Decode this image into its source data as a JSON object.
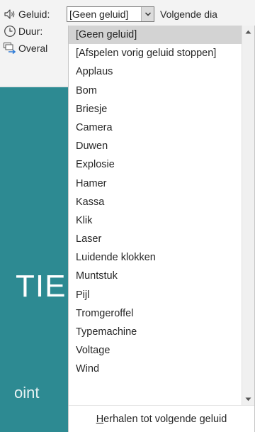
{
  "toolbar": {
    "sound_label": "Geluid:",
    "sound_value": "[Geen geluid]",
    "next_slide_label": "Volgende dia",
    "duration_label": "Duur:",
    "apply_all_label": "Overal"
  },
  "slide_preview": {
    "big_text": "TIE",
    "small_text": "oint"
  },
  "sound_list": {
    "items": [
      "[Geen geluid]",
      "[Afspelen vorig geluid stoppen]",
      "Applaus",
      "Bom",
      "Briesje",
      "Camera",
      "Duwen",
      "Explosie",
      "Hamer",
      "Kassa",
      "Klik",
      "Laser",
      "Luidende klokken",
      "Muntstuk",
      "Pijl",
      "Tromgeroffel",
      "Typemachine",
      "Voltage",
      "Wind"
    ],
    "selected_index": 0,
    "loop_option_first": "H",
    "loop_option_rest": "erhalen tot volgende geluid"
  },
  "icons": {
    "sound": "speaker-icon",
    "duration": "clock-icon",
    "apply_all": "apply-all-icon",
    "dropdown": "chevron-down-icon",
    "scroll_up": "scroll-up-arrow-icon",
    "scroll_down": "scroll-down-arrow-icon"
  },
  "colors": {
    "slide_bg": "#2d8a92",
    "selected_item_bg": "#d3d3d3",
    "apply_all_accent": "#2e7bd6"
  }
}
